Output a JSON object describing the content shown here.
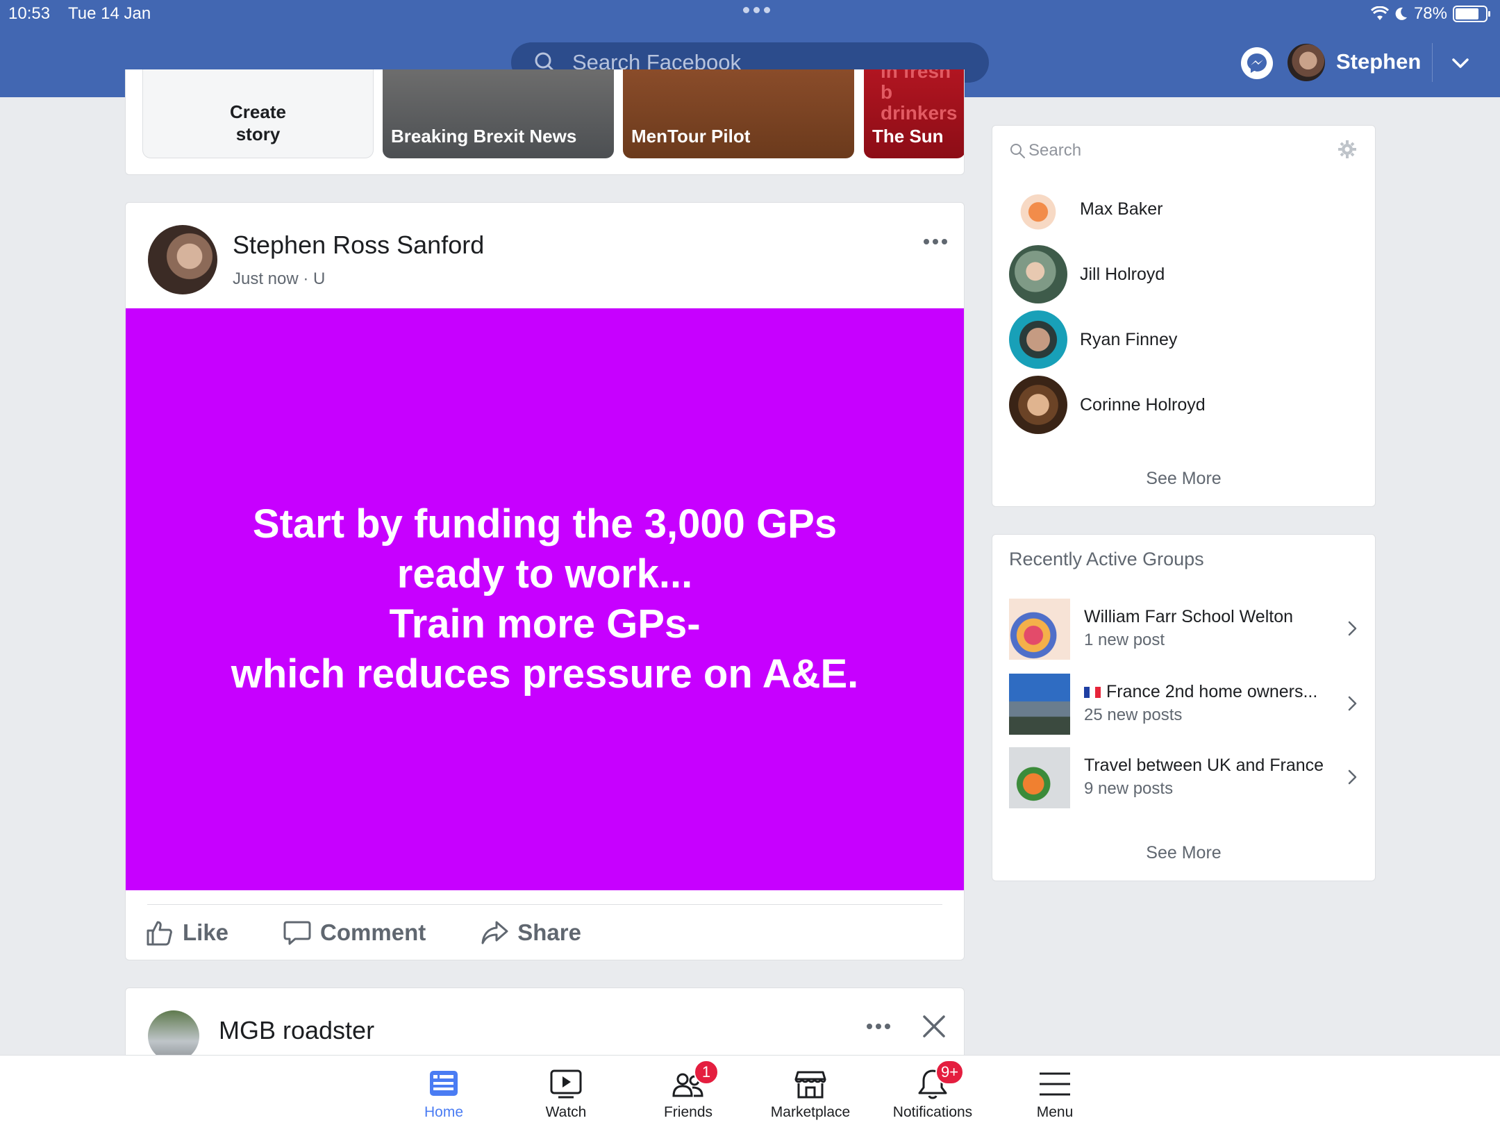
{
  "status_bar": {
    "time": "10:53",
    "date": "Tue 14 Jan",
    "battery": "78%",
    "battery_level": 0.78
  },
  "header": {
    "search_placeholder": "Search Facebook",
    "username": "Stephen"
  },
  "stories": [
    {
      "label": "Create\nstory"
    },
    {
      "label": "Breaking Brexit News"
    },
    {
      "label": "MenTour Pilot"
    },
    {
      "label": "The Sun",
      "behind_text": "in fresh b\ndrinkers"
    }
  ],
  "post": {
    "author": "Stephen Ross Sanford",
    "meta": "Just now · U",
    "text": "Start by funding the 3,000 GPs\nready to work...\nTrain more GPs-\nwhich reduces pressure on A&E.",
    "background_color": "#c700ff",
    "actions": {
      "like": "Like",
      "comment": "Comment",
      "share": "Share"
    }
  },
  "post2": {
    "author": "MGB roadster"
  },
  "contacts": {
    "search_placeholder": "Search",
    "items": [
      {
        "name": "Max Baker"
      },
      {
        "name": "Jill Holroyd"
      },
      {
        "name": "Ryan Finney"
      },
      {
        "name": "Corinne Holroyd"
      }
    ],
    "see_more": "See More"
  },
  "groups": {
    "title": "Recently Active Groups",
    "items": [
      {
        "name": "William Farr School Welton",
        "sub": "1 new post"
      },
      {
        "name": "France 2nd home owners...",
        "sub": "25 new posts"
      },
      {
        "name": "Travel between UK and France",
        "sub": "9 new posts"
      }
    ],
    "see_more": "See More"
  },
  "bottom_nav": [
    {
      "label": "Home",
      "icon": "home-icon",
      "active": true
    },
    {
      "label": "Watch",
      "icon": "watch-icon"
    },
    {
      "label": "Friends",
      "icon": "friends-icon",
      "badge": "1"
    },
    {
      "label": "Marketplace",
      "icon": "marketplace-icon"
    },
    {
      "label": "Notifications",
      "icon": "bell-icon",
      "badge": "9+"
    },
    {
      "label": "Menu",
      "icon": "menu-icon"
    }
  ],
  "colors": {
    "brand": "#4267b2",
    "active_tab": "#4a7cf3",
    "badge": "#e41e3f"
  }
}
